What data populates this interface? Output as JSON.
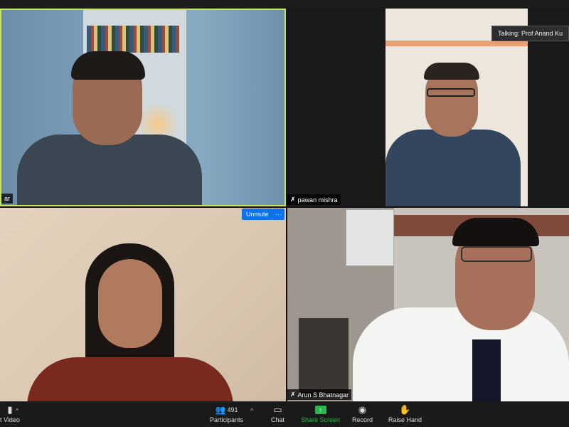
{
  "talking_indicator": "Talking: Prof Anand Ku",
  "participants": [
    {
      "name": "ar",
      "muted": false
    },
    {
      "name": "pawan mishra",
      "muted": true
    },
    {
      "name": "",
      "muted": false
    },
    {
      "name": "Arun S Bhatnagar",
      "muted": true
    }
  ],
  "tile3_controls": {
    "unmute_label": "Unmute",
    "more_label": "···"
  },
  "toolbar": {
    "video_label": "t Video",
    "participants_label": "Participants",
    "participants_count": "491",
    "chat_label": "Chat",
    "share_label": "Share Screen",
    "record_label": "Record",
    "raise_hand_label": "Raise Hand"
  },
  "colors": {
    "active_speaker_border": "#c9e35b",
    "share_green": "#2db64d",
    "unmute_blue": "#0e72ed"
  }
}
